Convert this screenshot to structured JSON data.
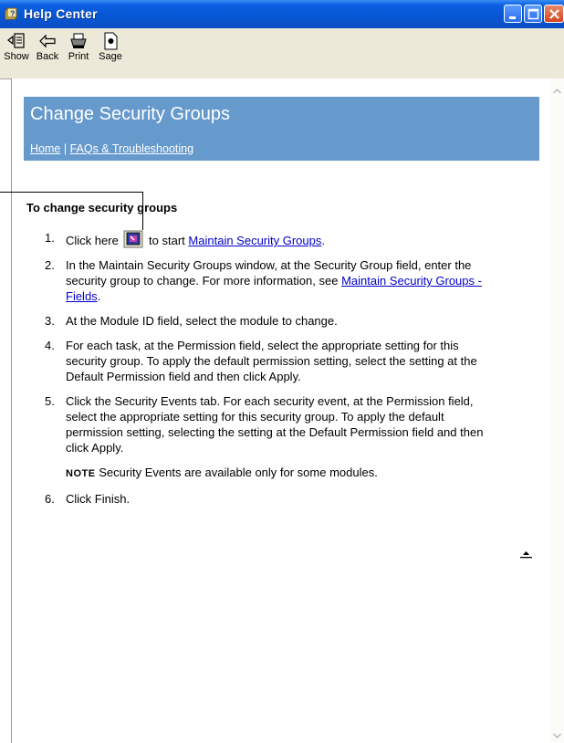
{
  "window": {
    "title": "Help Center",
    "icon": "help-book-icon",
    "title_bar_color": "#0a5fe0",
    "controls": [
      "minimize",
      "maximize",
      "close"
    ]
  },
  "toolbar": {
    "show_label": "Show",
    "back_label": "Back",
    "print_label": "Print",
    "sage_label": "Sage"
  },
  "header": {
    "background": "#6699cc",
    "title": "Change Security Groups",
    "breadcrumb": {
      "home": "Home",
      "separator": "|",
      "faqs": "FAQs & Troubleshooting"
    }
  },
  "article": {
    "heading": "To change security groups",
    "steps": [
      {
        "num": "1.",
        "pre": "Click here",
        "mid": "to start",
        "link": "Maintain Security Groups",
        "post": "."
      },
      {
        "num": "2.",
        "text": "In the Maintain Security Groups window, at the Security Group field, enter the security group to change. For more information, see",
        "link": "Maintain Security Groups - Fields",
        "post": "."
      },
      {
        "num": "3.",
        "text": "At the Module ID field, select the module to change."
      },
      {
        "num": "4.",
        "text": "For each task, at the Permission field, select the appropriate setting for this security group. To apply the default permission setting, select the setting at the Default Permission field and then click Apply."
      },
      {
        "num": "5.",
        "text": "Click the Security Events tab. For each security event, at the Permission field, select the appropriate setting for this security group. To apply the default permission setting, selecting the setting at the Default Permission field and then click Apply."
      },
      {
        "num": "6.",
        "text": "Click Finish."
      }
    ],
    "note": {
      "label": "NOTE",
      "text": "Security Events are available only for some modules."
    }
  }
}
